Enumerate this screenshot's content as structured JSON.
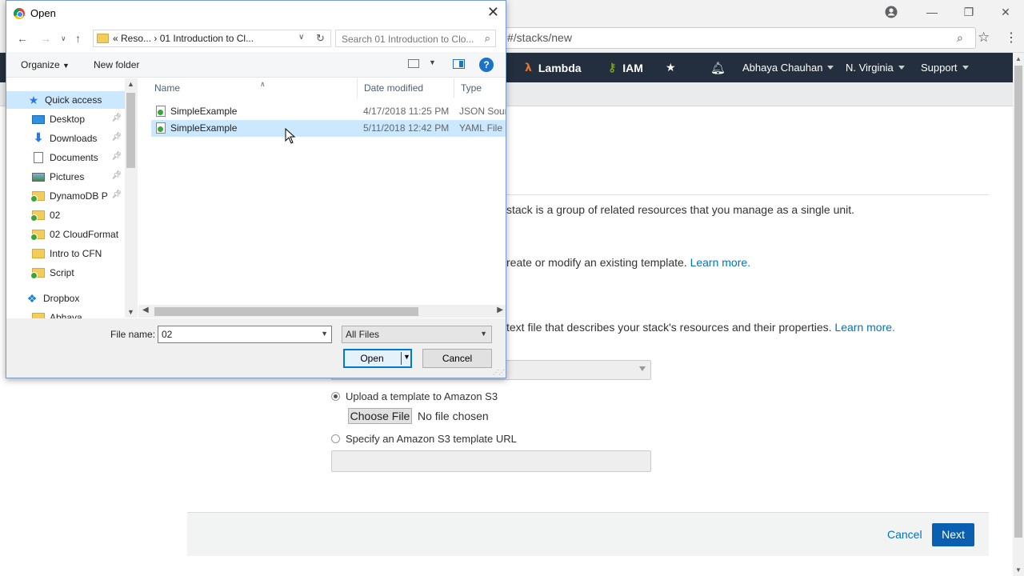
{
  "browser": {
    "address_partial": "#/stacks/new",
    "window_controls": [
      "minimize",
      "restore",
      "close"
    ]
  },
  "aws_nav": {
    "items": [
      {
        "label": "Lambda",
        "icon": "lambda-icon"
      },
      {
        "label": "IAM",
        "icon": "key-icon"
      }
    ],
    "user": "Abhaya Chauhan",
    "region": "N. Virginia",
    "support": "Support"
  },
  "page": {
    "stack_desc": "stack is a group of related resources that you manage as a single unit.",
    "template_desc": "reate or modify an existing template.",
    "template_learn_more": "Learn more.",
    "text_file_desc": "text file that describes your stack's resources and their properties.",
    "text_file_learn_more": "Learn more.",
    "upload_label": "Upload a template to Amazon S3",
    "choose_file": "Choose File",
    "no_file": "No file chosen",
    "s3_url_label": "Specify an Amazon S3 template URL",
    "cancel": "Cancel",
    "next": "Next"
  },
  "dialog": {
    "title": "Open",
    "breadcrumb": "«  Reso...  ›  01 Introduction to Cl...",
    "search_placeholder": "Search 01 Introduction to Clo...",
    "organize": "Organize",
    "new_folder": "New folder",
    "nav_items": [
      {
        "label": "Quick access",
        "icon": "star-icon",
        "pinned": false
      },
      {
        "label": "Desktop",
        "icon": "desktop-icon",
        "pinned": true
      },
      {
        "label": "Downloads",
        "icon": "download-icon",
        "pinned": true
      },
      {
        "label": "Documents",
        "icon": "documents-icon",
        "pinned": true
      },
      {
        "label": "Pictures",
        "icon": "pictures-icon",
        "pinned": true
      },
      {
        "label": "DynamoDB P",
        "icon": "folder-icon",
        "pinned": true
      },
      {
        "label": "02",
        "icon": "folder-icon",
        "pinned": false
      },
      {
        "label": "02 CloudFormat",
        "icon": "folder-icon",
        "pinned": false
      },
      {
        "label": "Intro to CFN",
        "icon": "folder-icon",
        "pinned": false
      },
      {
        "label": "Script",
        "icon": "folder-icon",
        "pinned": false
      },
      {
        "label": "Dropbox",
        "icon": "dropbox-icon",
        "pinned": false
      },
      {
        "label": "Abhaya",
        "icon": "folder-icon",
        "pinned": false
      }
    ],
    "columns": [
      "Name",
      "Date modified",
      "Type"
    ],
    "files": [
      {
        "name": "SimpleExample",
        "date": "4/17/2018 11:25 PM",
        "type": "JSON Source"
      },
      {
        "name": "SimpleExample",
        "date": "5/11/2018 12:42 PM",
        "type": "YAML File"
      }
    ],
    "file_name_label": "File name:",
    "file_name_value": "02",
    "filter": "All Files",
    "open": "Open",
    "cancel": "Cancel"
  }
}
